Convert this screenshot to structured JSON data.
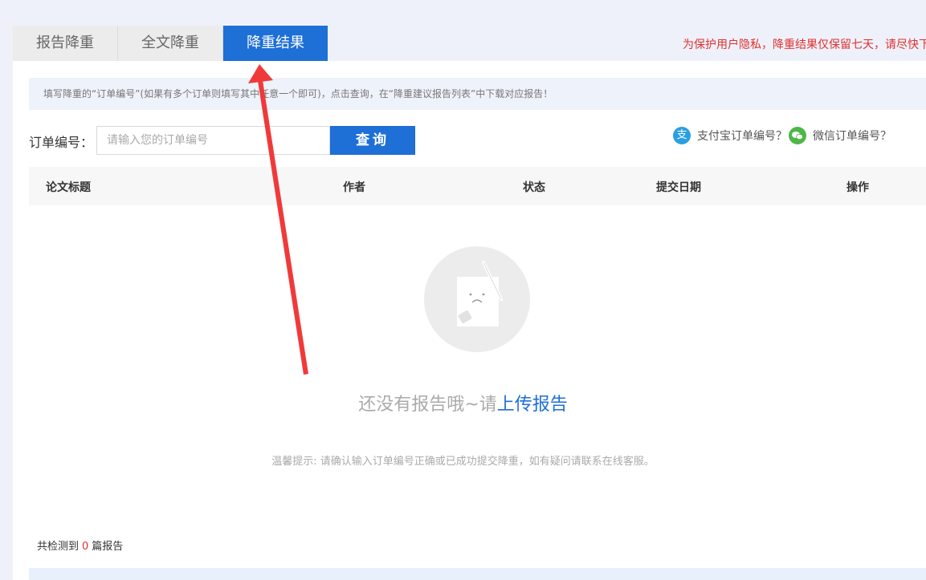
{
  "tabs": [
    {
      "label": "报告降重",
      "active": false
    },
    {
      "label": "全文降重",
      "active": false
    },
    {
      "label": "降重结果",
      "active": true
    }
  ],
  "privacy_notice": "为保护用户隐私，降重结果仅保留七天，请尽快下",
  "instruction": "填写降重的“订单编号”(如果有多个订单则填写其中任意一个即可)，点击查询，在“降重建议报告列表”中下载对应报告！",
  "search": {
    "label": "订单编号：",
    "placeholder": "请输入您的订单编号",
    "value": "",
    "button": "查询"
  },
  "help_links": {
    "alipay": "支付宝订单编号？",
    "wechat": "微信订单编号？"
  },
  "table": {
    "columns": [
      "论文标题",
      "作者",
      "状态",
      "提交日期",
      "操作"
    ],
    "rows": []
  },
  "empty_state": {
    "text": "还没有报告哦~请",
    "link": "上传报告",
    "tip": "温馨提示: 请确认输入订单编号正确或已成功提交降重，如有疑问请联系在线客服。"
  },
  "summary": {
    "prefix": "共检测到",
    "count": "0",
    "suffix": "篇报告"
  },
  "colors": {
    "accent": "#1e6fd6",
    "warning_red": "#e0312f",
    "annotation_arrow": "#f03a3a"
  }
}
